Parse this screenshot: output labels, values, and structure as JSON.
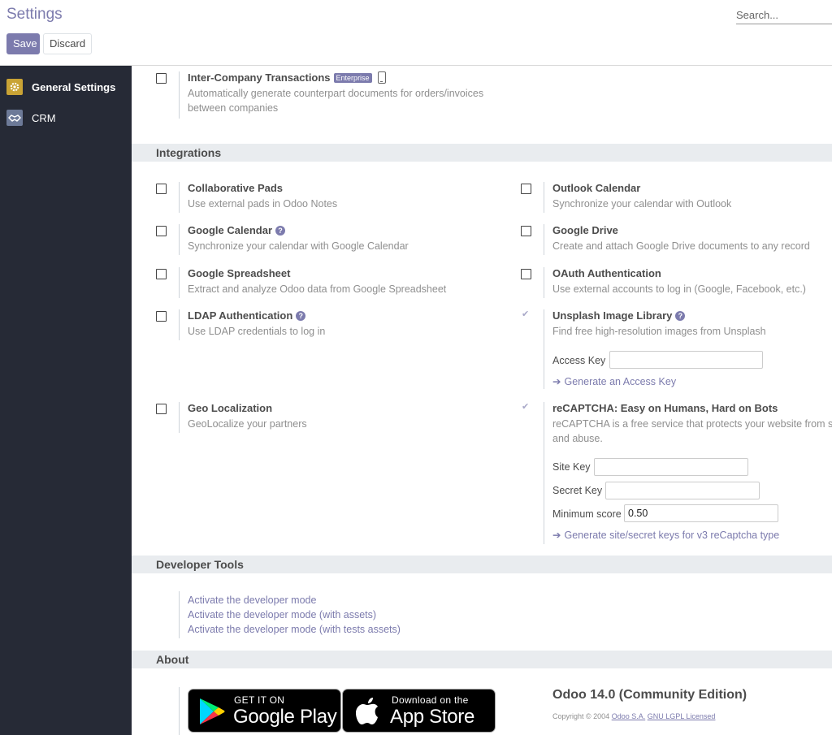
{
  "header": {
    "title": "Settings",
    "save_label": "Save",
    "discard_label": "Discard",
    "search_placeholder": "Search..."
  },
  "sidebar": {
    "items": [
      {
        "label": "General Settings",
        "icon": "gear-icon"
      },
      {
        "label": "CRM",
        "icon": "handshake-icon"
      }
    ]
  },
  "inter_company": {
    "title": "Inter-Company Transactions",
    "badge": "Enterprise",
    "desc_line1": "Automatically generate counterpart documents for orders/invoices",
    "desc_line2": "between companies"
  },
  "integrations": {
    "heading": "Integrations",
    "collab_pads": {
      "title": "Collaborative Pads",
      "desc": "Use external pads in Odoo Notes"
    },
    "outlook": {
      "title": "Outlook Calendar",
      "desc": "Synchronize your calendar with Outlook"
    },
    "google_calendar": {
      "title": "Google Calendar",
      "desc": "Synchronize your calendar with Google Calendar"
    },
    "google_drive": {
      "title": "Google Drive",
      "desc": "Create and attach Google Drive documents to any record"
    },
    "google_spreadsheet": {
      "title": "Google Spreadsheet",
      "desc": "Extract and analyze Odoo data from Google Spreadsheet"
    },
    "oauth": {
      "title": "OAuth Authentication",
      "desc": "Use external accounts to log in (Google, Facebook, etc.)"
    },
    "ldap": {
      "title": "LDAP Authentication",
      "desc": "Use LDAP credentials to log in"
    },
    "unsplash": {
      "title": "Unsplash Image Library",
      "desc": "Find free high-resolution images from Unsplash",
      "access_key_label": "Access Key",
      "access_key_value": "",
      "generate_link": "Generate an Access Key"
    },
    "geo": {
      "title": "Geo Localization",
      "desc": "GeoLocalize your partners"
    },
    "recaptcha": {
      "title": "reCAPTCHA: Easy on Humans, Hard on Bots",
      "desc_line1": "reCAPTCHA is a free service that protects your website from sp",
      "desc_line2": "and abuse.",
      "site_key_label": "Site Key",
      "site_key_value": "",
      "secret_key_label": "Secret Key",
      "secret_key_value": "",
      "min_score_label": "Minimum score",
      "min_score_value": "0.50",
      "generate_link": "Generate site/secret keys for v3 reCaptcha type"
    }
  },
  "developer_tools": {
    "heading": "Developer Tools",
    "links": [
      "Activate the developer mode",
      "Activate the developer mode (with assets)",
      "Activate the developer mode (with tests assets)"
    ]
  },
  "about": {
    "heading": "About",
    "google_play_top": "GET IT ON",
    "google_play_main": "Google Play",
    "app_store_top": "Download on the",
    "app_store_main": "App Store",
    "version": "Odoo 14.0 (Community Edition)",
    "copyright_prefix": "Copyright © 2004",
    "company_link": "Odoo S.A.",
    "license_link": "GNU LGPL Licensed"
  },
  "colors": {
    "primary": "#7c7bad",
    "sidebar_bg": "#262a36",
    "section_bg": "#e9ecef"
  }
}
